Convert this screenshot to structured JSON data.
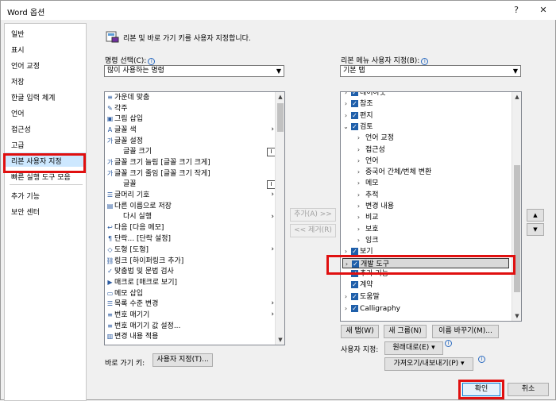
{
  "window": {
    "title": "Word 옵션",
    "help": "?",
    "close": "✕"
  },
  "nav": {
    "items": [
      "일반",
      "표시",
      "언어 교정",
      "저장",
      "한글 입력 체계",
      "언어",
      "접근성",
      "고급",
      "리본 사용자 지정",
      "빠른 실행 도구 모음",
      "추가 기능",
      "보안 센터"
    ],
    "selected": "리본 사용자 지정"
  },
  "header": {
    "text": "리본 및 바로 가기 키를 사용자 지정합니다."
  },
  "left": {
    "label": "명령 선택(C):",
    "combo": "많이 사용하는 명령",
    "commands": [
      {
        "icon": "≡",
        "label": "가운데 맞춤"
      },
      {
        "icon": "✎",
        "label": "각주"
      },
      {
        "icon": "▣",
        "label": "그림 삽입"
      },
      {
        "icon": "A",
        "label": "글꼴 색",
        "arrow": "›"
      },
      {
        "icon": "가",
        "label": "글꼴 설정"
      },
      {
        "icon": "",
        "label": "글꼴 크기",
        "marker": "I"
      },
      {
        "icon": "가",
        "label": "글꼴 크기 늘림 [글꼴 크기 크게]"
      },
      {
        "icon": "가",
        "label": "글꼴 크기 줄임 [글꼴 크기 작게]"
      },
      {
        "icon": "",
        "label": "글꼴",
        "marker": "I"
      },
      {
        "icon": "☰",
        "label": "글머리 기호",
        "arrow": "›"
      },
      {
        "icon": "▤",
        "label": "다른 이름으로 저장"
      },
      {
        "icon": "",
        "label": "다시 실행",
        "arrow": "›"
      },
      {
        "icon": "↩",
        "label": "다음 [다음 메모]"
      },
      {
        "icon": "¶",
        "label": "단락... [단락 설정]"
      },
      {
        "icon": "◇",
        "label": "도형 [도형]",
        "arrow": "›"
      },
      {
        "icon": "⛓",
        "label": "링크 [하이퍼링크 추가]"
      },
      {
        "icon": "✓",
        "label": "맞춤법 및 문법 검사"
      },
      {
        "icon": "▶",
        "label": "매크로 [매크로 보기]"
      },
      {
        "icon": "▭",
        "label": "메모 삽입"
      },
      {
        "icon": "☰",
        "label": "목록 수준 변경",
        "arrow": "›"
      },
      {
        "icon": "≡",
        "label": "번호 매기기",
        "arrow": "›"
      },
      {
        "icon": "≡",
        "label": "번호 매기기 값 설정..."
      },
      {
        "icon": "▥",
        "label": "변경 내용 적용"
      }
    ]
  },
  "middle": {
    "add": "추가(A) >>",
    "remove": "<< 제거(R)"
  },
  "right": {
    "label": "리본 메뉴 사용자 지정(B):",
    "combo": "기본 탭",
    "tree": [
      {
        "level": 0,
        "exp": "›",
        "chk": true,
        "label": "레이아웃"
      },
      {
        "level": 0,
        "exp": "›",
        "chk": true,
        "label": "참조"
      },
      {
        "level": 0,
        "exp": "›",
        "chk": true,
        "label": "편지"
      },
      {
        "level": 0,
        "exp": "⌄",
        "chk": true,
        "label": "검토"
      },
      {
        "level": 1,
        "exp": "›",
        "chk": false,
        "label": "언어 교정"
      },
      {
        "level": 1,
        "exp": "›",
        "chk": false,
        "label": "접근성"
      },
      {
        "level": 1,
        "exp": "›",
        "chk": false,
        "label": "언어"
      },
      {
        "level": 1,
        "exp": "›",
        "chk": false,
        "label": "중국어 간체/번체 변환"
      },
      {
        "level": 1,
        "exp": "›",
        "chk": false,
        "label": "메모"
      },
      {
        "level": 1,
        "exp": "›",
        "chk": false,
        "label": "추적"
      },
      {
        "level": 1,
        "exp": "›",
        "chk": false,
        "label": "변경 내용"
      },
      {
        "level": 1,
        "exp": "›",
        "chk": false,
        "label": "비교"
      },
      {
        "level": 1,
        "exp": "›",
        "chk": false,
        "label": "보호"
      },
      {
        "level": 1,
        "exp": "›",
        "chk": false,
        "label": "잉크"
      },
      {
        "level": 0,
        "exp": "›",
        "chk": true,
        "label": "보기"
      },
      {
        "level": 0,
        "exp": "›",
        "chk": true,
        "label": "개발 도구"
      },
      {
        "level": 0,
        "exp": "",
        "chk": true,
        "label": "추가 기능"
      },
      {
        "level": 0,
        "exp": "",
        "chk": true,
        "label": "계약"
      },
      {
        "level": 0,
        "exp": "›",
        "chk": true,
        "label": "도움말"
      },
      {
        "level": 0,
        "exp": "›",
        "chk": true,
        "label": "Calligraphy"
      }
    ],
    "new_tab": "새 탭(W)",
    "new_group": "새 그룹(N)",
    "rename": "이름 바꾸기(M)...",
    "custom_label": "사용자 지정:",
    "reset": "원래대로(E) ▾",
    "import_export": "가져오기/내보내기(P) ▾"
  },
  "shortcut": {
    "label": "바로 가기 키:",
    "button": "사용자 지정(T)..."
  },
  "footer": {
    "ok": "확인",
    "cancel": "취소"
  }
}
